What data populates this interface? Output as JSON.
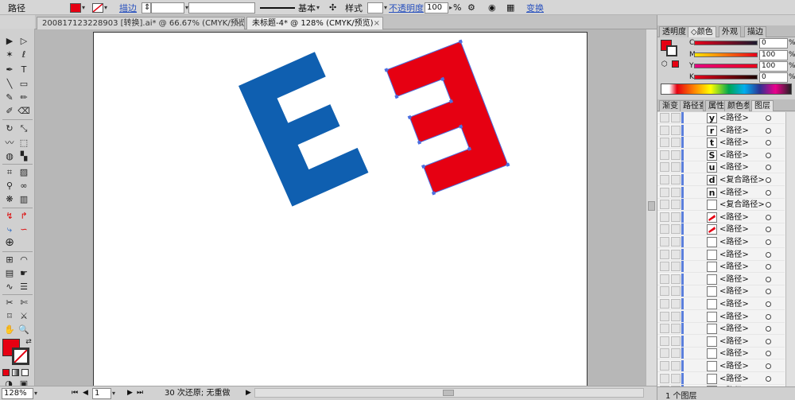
{
  "control_bar": {
    "object_type": "路径",
    "fill_color": "#e60012",
    "stroke_label": "描边",
    "stroke_value": "",
    "brush_label": "基本",
    "style_label": "样式",
    "opacity_label": "不透明度",
    "opacity_value": "100",
    "opacity_unit": "%",
    "transform_link": "变换"
  },
  "tabs": [
    {
      "label": "20081712322890​3 [转换].ai* @ 66.67% (CMYK/预览)",
      "close": "×"
    },
    {
      "label": "未标题-4* @ 128% (CMYK/预览)",
      "close": "×"
    }
  ],
  "artwork": {
    "blue_color": "#0f5fb0",
    "red_color": "#e60012",
    "selection_color": "#4b6fe0"
  },
  "status": {
    "zoom": "128%",
    "page": "1",
    "undo_text": "30 次还原; 无重做"
  },
  "color_panel": {
    "tabs": [
      "透明度",
      "颜色",
      "外观",
      "描边"
    ],
    "active_tab": "颜色",
    "channels": [
      {
        "label": "C",
        "value": "0",
        "unit": "%"
      },
      {
        "label": "M",
        "value": "100",
        "unit": "%"
      },
      {
        "label": "Y",
        "value": "100",
        "unit": "%"
      },
      {
        "label": "K",
        "value": "0",
        "unit": "%"
      }
    ]
  },
  "layers_panel": {
    "tabs": [
      "渐变",
      "路径查",
      "属性",
      "颜色参",
      "图层"
    ],
    "active_tab": "图层",
    "rows": [
      {
        "thumb": "y",
        "name": "<路径>"
      },
      {
        "thumb": "r",
        "name": "<路径>"
      },
      {
        "thumb": "t",
        "name": "<路径>"
      },
      {
        "thumb": "S",
        "name": "<路径>"
      },
      {
        "thumb": "u",
        "name": "<路径>"
      },
      {
        "thumb": "d",
        "name": "<复合路径>"
      },
      {
        "thumb": "n",
        "name": "<路径>"
      },
      {
        "thumb": "",
        "name": "<复合路径>"
      },
      {
        "thumb": "red",
        "name": "<路径>"
      },
      {
        "thumb": "red",
        "name": "<路径>"
      },
      {
        "thumb": "",
        "name": "<路径>"
      },
      {
        "thumb": "",
        "name": "<路径>"
      },
      {
        "thumb": "",
        "name": "<路径>"
      },
      {
        "thumb": "",
        "name": "<路径>"
      },
      {
        "thumb": "",
        "name": "<路径>"
      },
      {
        "thumb": "",
        "name": "<路径>"
      },
      {
        "thumb": "",
        "name": "<路径>"
      },
      {
        "thumb": "",
        "name": "<路径>"
      },
      {
        "thumb": "",
        "name": "<路径>"
      },
      {
        "thumb": "",
        "name": "<路径>"
      },
      {
        "thumb": "",
        "name": "<路径>"
      },
      {
        "thumb": "",
        "name": "<路径>"
      },
      {
        "thumb": "red",
        "name": "<路径>"
      },
      {
        "thumb": "",
        "name": "<路径>"
      }
    ],
    "footer": "1 个图层"
  }
}
